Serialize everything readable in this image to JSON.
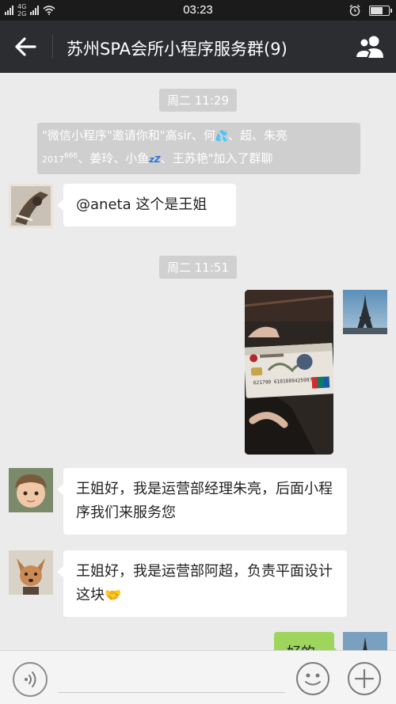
{
  "status_bar": {
    "time": "03:23",
    "network_1": "4G",
    "network_2": "2G",
    "battery_percent": 70
  },
  "header": {
    "title": "苏州SPA会所小程序服务群(9)"
  },
  "messages": {
    "time_1": "周二 11:29",
    "system_parts": [
      "\"微信小程序\"邀请你和\"高sir、何",
      "、超、朱亮",
      "2017",
      "666",
      "、姜玲、小鱼",
      "zZ",
      "、王苏艳\"加入了群聊"
    ],
    "msg_1": "@aneta 这个是王姐",
    "time_2": "周二 11:51",
    "card_number": "621790 6101009425997",
    "msg_2": "王姐好，我是运营部经理朱亮，后面小程序我们来服务您",
    "msg_3": "王姐好，我是运营部阿超，负责平面设计这块",
    "msg_4": "好的"
  },
  "input": {
    "value": ""
  }
}
